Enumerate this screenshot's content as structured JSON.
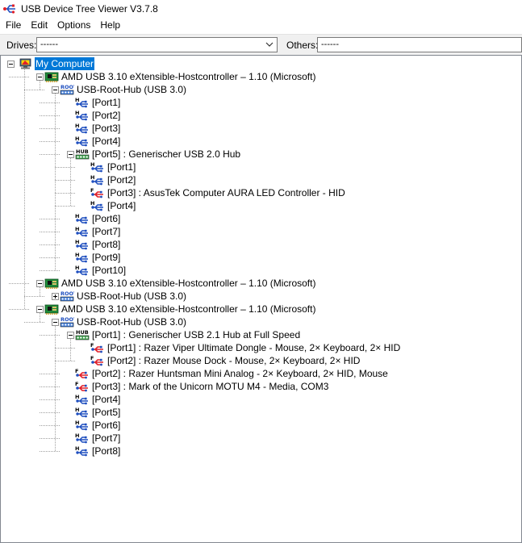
{
  "window": {
    "title": "USB Device Tree Viewer V3.7.8"
  },
  "menu": [
    "File",
    "Edit",
    "Options",
    "Help"
  ],
  "toolbar": {
    "drives_label": "Drives:",
    "drives_value": "------",
    "others_label": "Others:",
    "others_value": "------"
  },
  "tree": [
    {
      "label": "My Computer",
      "level": 0,
      "icon": "computer-icon",
      "expander": "minus",
      "selected": true
    },
    {
      "label": "AMD USB 3.10 eXtensible-Hostcontroller – 1.10 (Microsoft)",
      "level": 1,
      "icon": "host-controller-icon",
      "expander": "minus"
    },
    {
      "label": "USB-Root-Hub (USB 3.0)",
      "level": 2,
      "icon": "root-hub-icon",
      "expander": "minus"
    },
    {
      "label": "[Port1]",
      "level": 3,
      "icon": "usb-port-icon"
    },
    {
      "label": "[Port2]",
      "level": 3,
      "icon": "usb-port-icon"
    },
    {
      "label": "[Port3]",
      "level": 3,
      "icon": "usb-port-icon"
    },
    {
      "label": "[Port4]",
      "level": 3,
      "icon": "usb-port-icon"
    },
    {
      "label": "[Port5] : Generischer USB 2.0 Hub",
      "level": 3,
      "icon": "hub-icon",
      "expander": "minus"
    },
    {
      "label": "[Port1]",
      "level": 4,
      "icon": "usb-port-icon"
    },
    {
      "label": "[Port2]",
      "level": 4,
      "icon": "usb-port-icon"
    },
    {
      "label": "[Port3] : AsusTek Computer AURA LED Controller - HID",
      "level": 4,
      "icon": "usb-device-icon"
    },
    {
      "label": "[Port4]",
      "level": 4,
      "icon": "usb-port-icon"
    },
    {
      "label": "[Port6]",
      "level": 3,
      "icon": "usb-port-icon"
    },
    {
      "label": "[Port7]",
      "level": 3,
      "icon": "usb-port-icon"
    },
    {
      "label": "[Port8]",
      "level": 3,
      "icon": "usb-port-icon"
    },
    {
      "label": "[Port9]",
      "level": 3,
      "icon": "usb-port-icon"
    },
    {
      "label": "[Port10]",
      "level": 3,
      "icon": "usb-port-icon"
    },
    {
      "label": "AMD USB 3.10 eXtensible-Hostcontroller – 1.10 (Microsoft)",
      "level": 1,
      "icon": "host-controller-icon",
      "expander": "minus"
    },
    {
      "label": "USB-Root-Hub (USB 3.0)",
      "level": 2,
      "icon": "root-hub-icon",
      "expander": "plus"
    },
    {
      "label": "AMD USB 3.10 eXtensible-Hostcontroller – 1.10 (Microsoft)",
      "level": 1,
      "icon": "host-controller-icon",
      "expander": "minus"
    },
    {
      "label": "USB-Root-Hub (USB 3.0)",
      "level": 2,
      "icon": "root-hub-icon",
      "expander": "minus"
    },
    {
      "label": "[Port1] : Generischer USB 2.1 Hub at Full Speed",
      "level": 3,
      "icon": "hub-icon",
      "expander": "minus"
    },
    {
      "label": "[Port1] : Razer Viper Ultimate Dongle - Mouse, 2× Keyboard, 2× HID",
      "level": 4,
      "icon": "usb-device-icon"
    },
    {
      "label": "[Port2] : Razer Mouse Dock - Mouse, 2× Keyboard, 2× HID",
      "level": 4,
      "icon": "usb-device-icon"
    },
    {
      "label": "[Port2] : Razer Huntsman Mini Analog - 2× Keyboard, 2× HID, Mouse",
      "level": 3,
      "icon": "usb-device-icon"
    },
    {
      "label": "[Port3] : Mark of the Unicorn MOTU M4 - Media, COM3",
      "level": 3,
      "icon": "usb-device-icon"
    },
    {
      "label": "[Port4]",
      "level": 3,
      "icon": "usb-port-icon"
    },
    {
      "label": "[Port5]",
      "level": 3,
      "icon": "usb-port-icon"
    },
    {
      "label": "[Port6]",
      "level": 3,
      "icon": "usb-port-icon"
    },
    {
      "label": "[Port7]",
      "level": 3,
      "icon": "usb-port-icon"
    },
    {
      "label": "[Port8]",
      "level": 3,
      "icon": "usb-port-icon"
    }
  ],
  "colors": {
    "selection": "#0078d7",
    "usb_blue": "#1f4fbf",
    "usb_red": "#e0202a",
    "board_green": "#1f8a3a"
  },
  "icon_text": {
    "root": "ROOT",
    "hub": "HUB",
    "h": "H",
    "f": "F"
  }
}
